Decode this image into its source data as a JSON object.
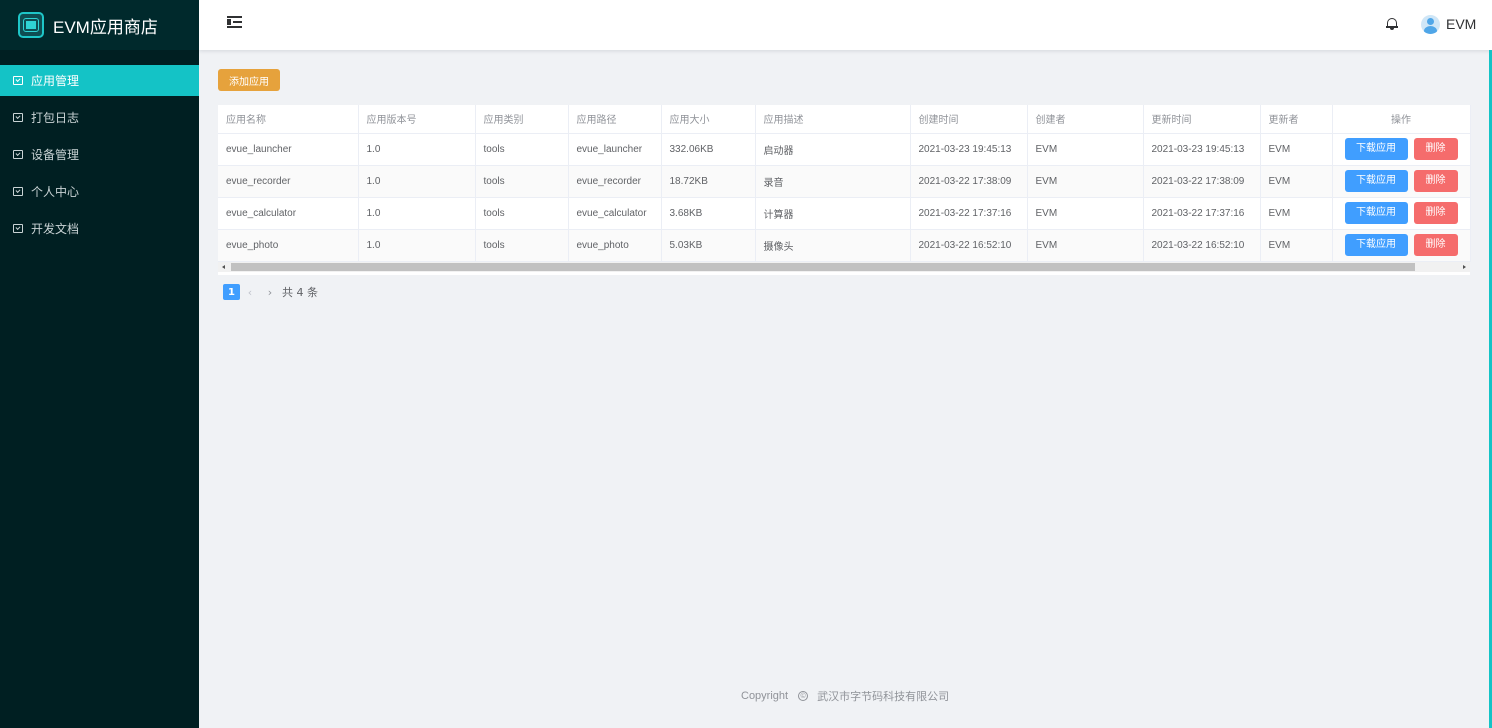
{
  "sidebar": {
    "brand": "EVM应用商店",
    "items": [
      {
        "label": "应用管理",
        "active": true
      },
      {
        "label": "打包日志",
        "active": false
      },
      {
        "label": "设备管理",
        "active": false
      },
      {
        "label": "个人中心",
        "active": false
      },
      {
        "label": "开发文档",
        "active": false
      }
    ]
  },
  "header": {
    "username": "EVM",
    "icons": [
      "menu-fold-icon",
      "bell-icon",
      "avatar"
    ]
  },
  "toolbar": {
    "add_label": "添加应用"
  },
  "table": {
    "columns": [
      "应用名称",
      "应用版本号",
      "应用类别",
      "应用路径",
      "应用大小",
      "应用描述",
      "创建时间",
      "创建者",
      "更新时间",
      "更新者",
      "操作"
    ],
    "rows": [
      [
        "evue_launcher",
        "1.0",
        "tools",
        "evue_launcher",
        "332.06KB",
        "启动器",
        "2021-03-23 19:45:13",
        "EVM",
        "2021-03-23 19:45:13",
        "EVM"
      ],
      [
        "evue_recorder",
        "1.0",
        "tools",
        "evue_recorder",
        "18.72KB",
        "录音",
        "2021-03-22 17:38:09",
        "EVM",
        "2021-03-22 17:38:09",
        "EVM"
      ],
      [
        "evue_calculator",
        "1.0",
        "tools",
        "evue_calculator",
        "3.68KB",
        "计算器",
        "2021-03-22 17:37:16",
        "EVM",
        "2021-03-22 17:37:16",
        "EVM"
      ],
      [
        "evue_photo",
        "1.0",
        "tools",
        "evue_photo",
        "5.03KB",
        "摄像头",
        "2021-03-22 16:52:10",
        "EVM",
        "2021-03-22 16:52:10",
        "EVM"
      ]
    ],
    "download_label": "下载应用",
    "delete_label": "删除"
  },
  "pagination": {
    "current_page": "1",
    "prev": "‹",
    "next": "›",
    "total": "共 4 条"
  },
  "footer": {
    "copyright": "Copyright",
    "symbol": "©",
    "company": "武汉市字节码科技有限公司"
  },
  "colors": {
    "sidebar_bg": "#001f22",
    "accent": "#14c3c6",
    "primary": "#409eff",
    "danger": "#f56c6c",
    "warning": "#e6a23c"
  }
}
